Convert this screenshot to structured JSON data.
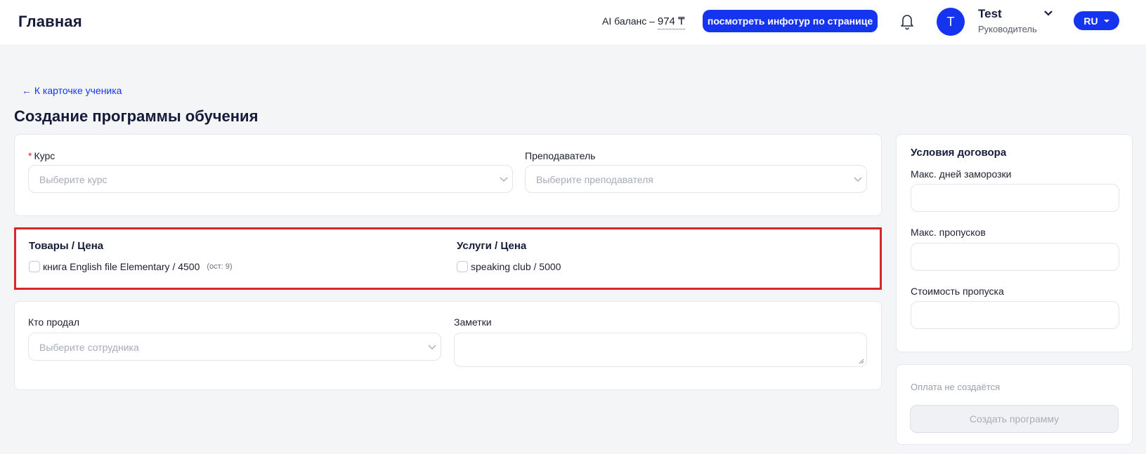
{
  "header": {
    "logo": "Главная",
    "ai_balance_label": "AI баланс –",
    "ai_balance_amount": "974 ₸",
    "tour_button": "посмотреть инфотур по странице",
    "avatar_letter": "T",
    "user_name": "Test",
    "user_role": "Руководитель",
    "language": "RU"
  },
  "nav": {
    "back_link": "← К карточке ученика"
  },
  "page": {
    "title": "Создание программы обучения"
  },
  "course_card": {
    "course_label": "Курс",
    "course_placeholder": "Выберите курс",
    "teacher_label": "Преподаватель",
    "teacher_placeholder": "Выберите преподавателя"
  },
  "goods_services": {
    "goods_title": "Товары / Цена",
    "goods_items": [
      {
        "label": "книга English file Elementary / 4500",
        "stock": "(ост: 9)"
      }
    ],
    "services_title": "Услуги / Цена",
    "services_items": [
      {
        "label": "speaking club / 5000"
      }
    ]
  },
  "sale_card": {
    "seller_label": "Кто продал",
    "seller_placeholder": "Выберите сотрудника",
    "notes_label": "Заметки"
  },
  "contract": {
    "title": "Условия договора",
    "max_freeze_days_label": "Макс. дней заморозки",
    "max_absences_label": "Макс. пропусков",
    "absence_cost_label": "Стоимость пропуска"
  },
  "payment": {
    "note": "Оплата не создаётся",
    "create_button": "Создать программу"
  },
  "colors": {
    "accent": "#1534f0",
    "highlight": "#d9262b",
    "required": "#e02424"
  }
}
